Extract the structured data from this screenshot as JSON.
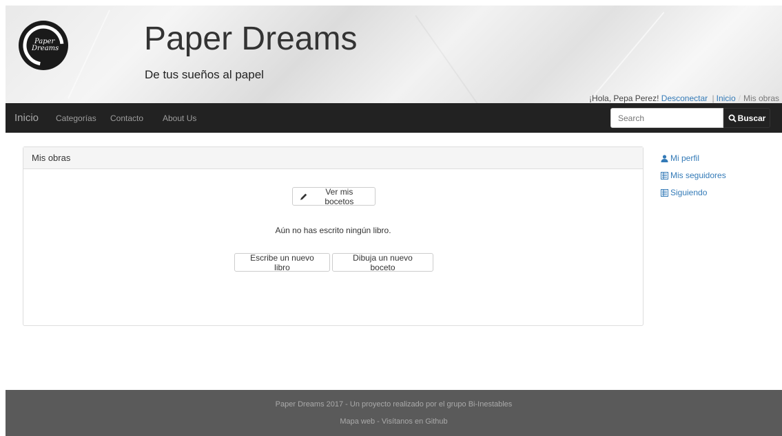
{
  "header": {
    "logo_text": "Paper Dreams",
    "title": "Paper Dreams",
    "subtitle": "De tus sueños al papel",
    "greeting": "¡Hola, Pepa Perez!",
    "logout": "Desconectar",
    "separator": "|",
    "crumb_home": "Inicio",
    "crumb_sep": "/",
    "crumb_current": "Mis obras"
  },
  "navbar": {
    "brand": "Inicio",
    "links": [
      "Categorías",
      "Contacto",
      "About Us"
    ],
    "search_placeholder": "Search",
    "search_button": "Buscar"
  },
  "panel": {
    "heading": "Mis obras",
    "sketches_button": "Ver mis bocetos",
    "empty_message": "Aún no has escrito ningún libro.",
    "new_book_button": "Escribe un nuevo libro",
    "new_sketch_button": "Dibuja un nuevo boceto"
  },
  "sidebar": {
    "items": [
      {
        "label": "Mi perfil",
        "icon": "user-icon"
      },
      {
        "label": "Mis seguidores",
        "icon": "list-icon"
      },
      {
        "label": "Siguiendo",
        "icon": "list-icon"
      }
    ]
  },
  "footer": {
    "line1": "Paper Dreams 2017 - Un proyecto realizado por el grupo Bi-Inestables",
    "sitemap": "Mapa web",
    "dash": " - ",
    "github": "Visítanos en Github"
  },
  "colors": {
    "navbar": "#222222",
    "link": "#337ab7",
    "footer": "#5a5a5a"
  }
}
